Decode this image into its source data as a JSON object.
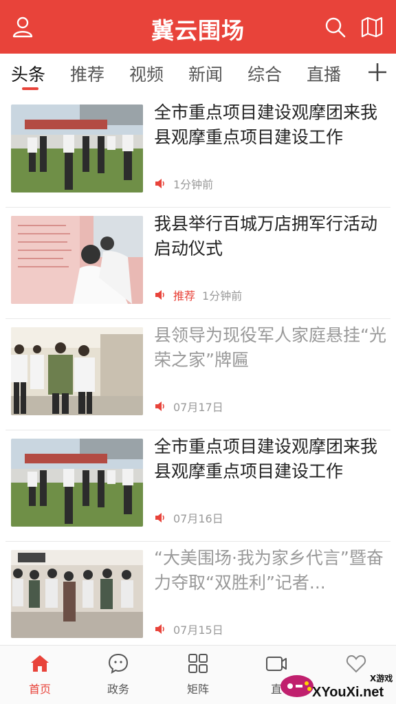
{
  "app": {
    "title": "冀云围场"
  },
  "tabs": [
    "头条",
    "推荐",
    "视频",
    "新闻",
    "综合",
    "直播"
  ],
  "articles": [
    {
      "title": "全市重点项目建设观摩团来我县观摩重点项目建设工作",
      "tag": "",
      "time": "1分钟前",
      "read": false
    },
    {
      "title": "我县举行百城万店拥军行活动启动仪式",
      "tag": "推荐",
      "time": "1分钟前",
      "read": false
    },
    {
      "title": "县领导为现役军人家庭悬挂“光荣之家”牌匾",
      "tag": "",
      "time": "07月17日",
      "read": true
    },
    {
      "title": "全市重点项目建设观摩团来我县观摩重点项目建设工作",
      "tag": "",
      "time": "07月16日",
      "read": false
    },
    {
      "title": "“大美围场·我为家乡代言”暨奋力夺取“双胜利”记者...",
      "tag": "",
      "time": "07月15日",
      "read": true
    }
  ],
  "bottom_nav": [
    "首页",
    "政务",
    "矩阵",
    "直"
  ],
  "watermark": {
    "text": "XYouXi.net",
    "small": "X游戏"
  },
  "colors": {
    "brand": "#e8433a",
    "read_text": "#999999"
  }
}
